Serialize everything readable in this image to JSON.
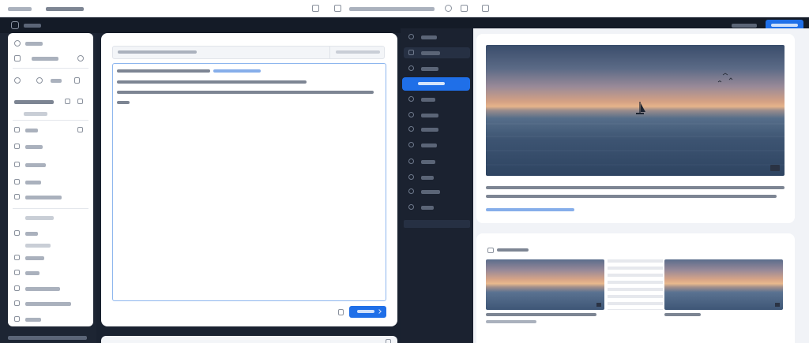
{
  "colors": {
    "accent": "#1f6fe8",
    "nav_bg": "#1b2230",
    "page_bg": "#f1f3f7",
    "card_bg": "#ffffff",
    "link": "#3b82e0"
  },
  "icons": {
    "logo": "app-logo-icon",
    "toolbar": [
      "filter-icon",
      "sliders-icon",
      "settings-icon",
      "eye-icon",
      "copy-icon"
    ],
    "sidebar": [
      "home-icon",
      "user-icon",
      "refresh-icon",
      "gear-icon",
      "info-icon",
      "grid-icon",
      "chart-icon",
      "doc-icon",
      "calendar-icon",
      "tag-icon",
      "folder-icon",
      "box-icon",
      "users-icon",
      "settings-icon",
      "info-icon"
    ],
    "middle_nav": [
      "layers-icon",
      "stack-icon",
      "magic-icon",
      "image-icon",
      "pencil-icon",
      "adjust-icon",
      "crop-icon",
      "type-icon",
      "circle-icon",
      "plus-icon"
    ],
    "preview_badge": "hd-badge-icon",
    "gallery_title": "image-icon",
    "send": "send-icon",
    "attach": "paperclip-icon"
  },
  "topbar": {
    "app_name": "",
    "breadcrumb": "",
    "center_label": "",
    "action_link": "",
    "primary_button": ""
  },
  "sidebar": {
    "items": [
      "",
      "",
      "",
      "",
      "",
      "",
      "",
      "",
      "",
      "",
      "",
      "",
      ""
    ]
  },
  "editor": {
    "field_placeholder": "",
    "counter": "",
    "text_line1": "",
    "text_link": "",
    "text_line2": "",
    "text_line3": "",
    "text_line4": "",
    "submit": ""
  },
  "middle_nav": {
    "items": [
      "",
      "",
      "",
      "",
      "",
      "",
      "",
      "",
      "",
      "",
      ""
    ],
    "active_index": 2
  },
  "preview": {
    "caption_line1": "",
    "caption_line2": "",
    "caption_link": ""
  },
  "gallery": {
    "title": "",
    "captions": [
      "",
      ""
    ]
  }
}
